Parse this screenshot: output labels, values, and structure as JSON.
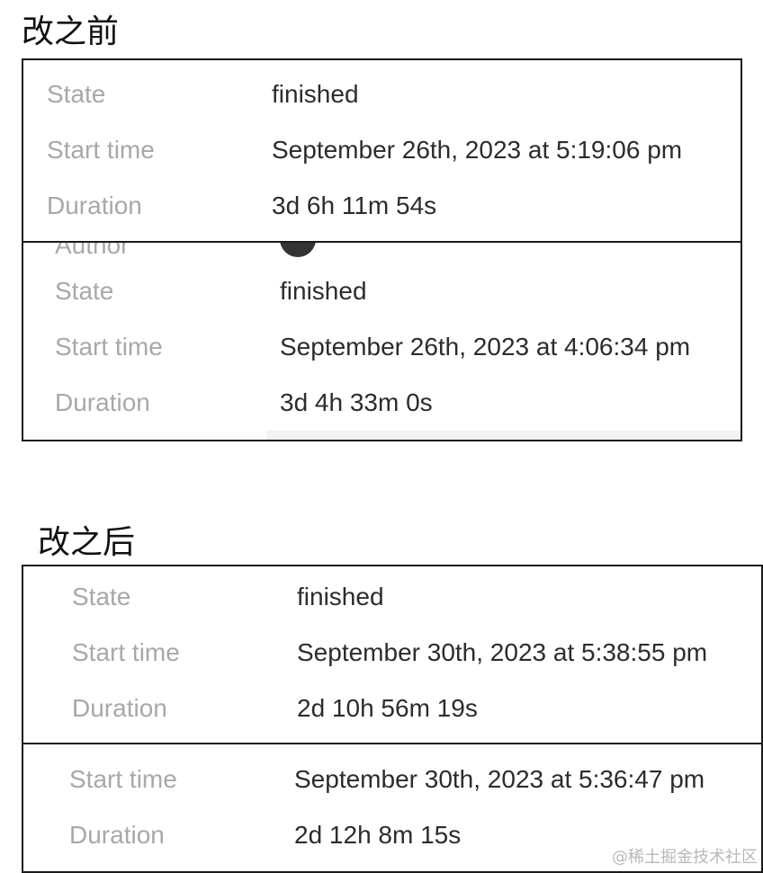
{
  "before": {
    "heading": "改之前",
    "panel_top": [
      {
        "label": "State",
        "value": "finished"
      },
      {
        "label": "Start time",
        "value": "September 26th, 2023 at 5:19:06 pm"
      },
      {
        "label": "Duration",
        "value": "3d 6h 11m 54s"
      }
    ],
    "panel_bottom": [
      {
        "label": "State",
        "value": "finished"
      },
      {
        "label": "Start time",
        "value": "September 26th, 2023 at 4:06:34 pm"
      },
      {
        "label": "Duration",
        "value": "3d 4h 33m 0s"
      }
    ]
  },
  "after": {
    "heading": "改之后",
    "panel_top": [
      {
        "label": "State",
        "value": "finished"
      },
      {
        "label": "Start time",
        "value": "September 30th, 2023 at 5:38:55 pm"
      },
      {
        "label": "Duration",
        "value": "2d 10h 56m 19s"
      }
    ],
    "panel_bottom": [
      {
        "label": "Start time",
        "value": "September 30th, 2023 at 5:36:47 pm"
      },
      {
        "label": "Duration",
        "value": "2d 12h 8m 15s"
      }
    ]
  },
  "watermark": "@稀土掘金技术社区"
}
